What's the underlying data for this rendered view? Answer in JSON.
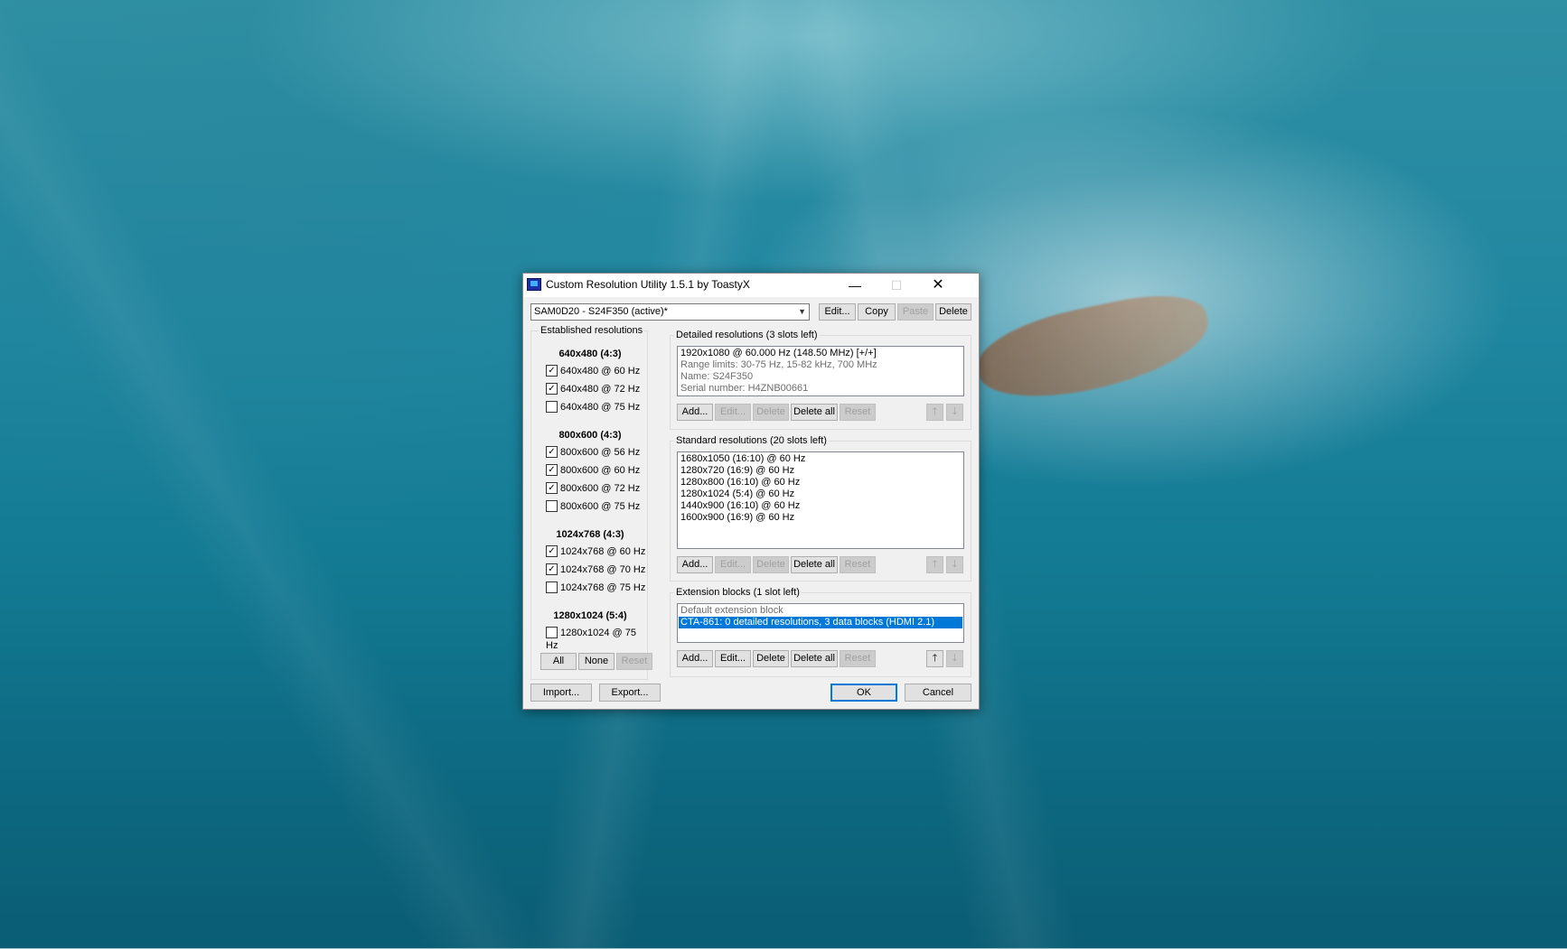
{
  "window": {
    "title": "Custom Resolution Utility 1.5.1 by ToastyX",
    "minimize_glyph": "—",
    "maximize_glyph": "☐",
    "close_glyph": "✕"
  },
  "toolbar": {
    "monitor_selected": "SAM0D20 - S24F350 (active)*",
    "edit": "Edit...",
    "copy": "Copy",
    "paste": "Paste",
    "delete": "Delete"
  },
  "established": {
    "title": "Established resolutions",
    "groups": [
      {
        "heading": "640x480 (4:3)",
        "items": [
          {
            "label": "640x480 @ 60 Hz",
            "checked": true
          },
          {
            "label": "640x480 @ 72 Hz",
            "checked": true
          },
          {
            "label": "640x480 @ 75 Hz",
            "checked": false
          }
        ]
      },
      {
        "heading": "800x600 (4:3)",
        "items": [
          {
            "label": "800x600 @ 56 Hz",
            "checked": true
          },
          {
            "label": "800x600 @ 60 Hz",
            "checked": true
          },
          {
            "label": "800x600 @ 72 Hz",
            "checked": true
          },
          {
            "label": "800x600 @ 75 Hz",
            "checked": false
          }
        ]
      },
      {
        "heading": "1024x768 (4:3)",
        "items": [
          {
            "label": "1024x768 @ 60 Hz",
            "checked": true
          },
          {
            "label": "1024x768 @ 70 Hz",
            "checked": true
          },
          {
            "label": "1024x768 @ 75 Hz",
            "checked": false
          }
        ]
      },
      {
        "heading": "1280x1024 (5:4)",
        "items": [
          {
            "label": "1280x1024 @ 75 Hz",
            "checked": false
          }
        ]
      }
    ],
    "all": "All",
    "none": "None",
    "reset": "Reset"
  },
  "detailed": {
    "title": "Detailed resolutions (3 slots left)",
    "lines": [
      "1920x1080 @ 60.000 Hz (148.50 MHz) [+/+]",
      "Range limits: 30-75 Hz, 15-82 kHz, 700 MHz",
      "Name: S24F350",
      "Serial number: H4ZNB00661"
    ],
    "add": "Add...",
    "edit": "Edit...",
    "delete": "Delete",
    "delete_all": "Delete all",
    "reset": "Reset"
  },
  "standard": {
    "title": "Standard resolutions (20 slots left)",
    "lines": [
      "1680x1050 (16:10) @ 60 Hz",
      "1280x720 (16:9) @ 60 Hz",
      "1280x800 (16:10) @ 60 Hz",
      "1280x1024 (5:4) @ 60 Hz",
      "1440x900 (16:10) @ 60 Hz",
      "1600x900 (16:9) @ 60 Hz"
    ],
    "add": "Add...",
    "edit": "Edit...",
    "delete": "Delete",
    "delete_all": "Delete all",
    "reset": "Reset"
  },
  "extension": {
    "title": "Extension blocks (1 slot left)",
    "lines": [
      "Default extension block",
      "CTA-861: 0 detailed resolutions, 3 data blocks (HDMI 2.1)"
    ],
    "add": "Add...",
    "edit": "Edit...",
    "delete": "Delete",
    "delete_all": "Delete all",
    "reset": "Reset"
  },
  "footer": {
    "import": "Import...",
    "export": "Export...",
    "ok": "OK",
    "cancel": "Cancel"
  },
  "icons": {
    "up": "🡑",
    "down": "🡓",
    "check": "✓",
    "dropdown": "▼"
  }
}
